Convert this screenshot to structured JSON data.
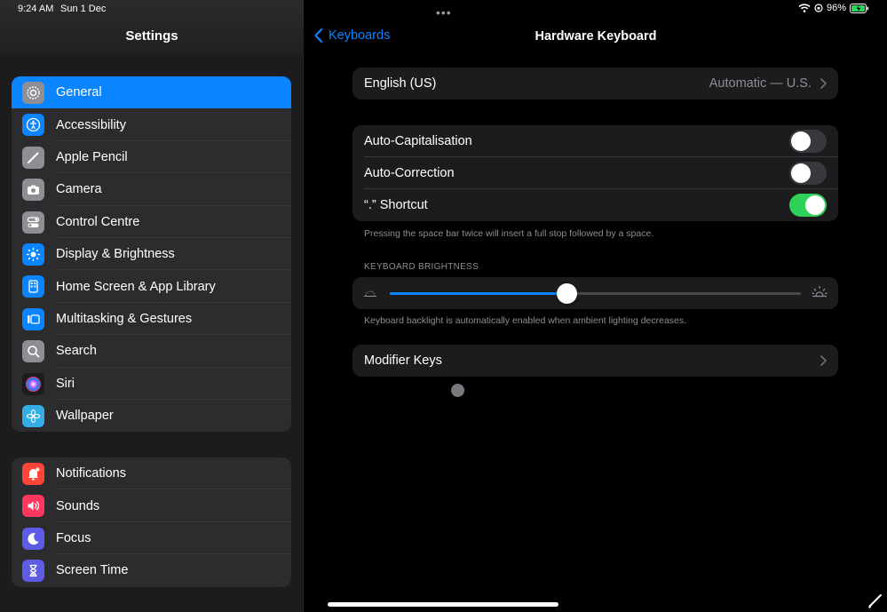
{
  "status_bar": {
    "time": "9:24 AM",
    "date": "Sun 1 Dec",
    "battery": "96%"
  },
  "sidebar": {
    "title": "Settings",
    "group1": [
      {
        "label": "General",
        "icon": "gear-icon",
        "color": "#8e8e93",
        "selected": true
      },
      {
        "label": "Accessibility",
        "icon": "accessibility-icon",
        "color": "#0a84ff"
      },
      {
        "label": "Apple Pencil",
        "icon": "pencil-icon",
        "color": "#8e8e93"
      },
      {
        "label": "Camera",
        "icon": "camera-icon",
        "color": "#8e8e93"
      },
      {
        "label": "Control Centre",
        "icon": "control-centre-icon",
        "color": "#8e8e93"
      },
      {
        "label": "Display & Brightness",
        "icon": "sun-icon",
        "color": "#0a84ff"
      },
      {
        "label": "Home Screen & App Library",
        "icon": "home-screen-icon",
        "color": "#0a84ff"
      },
      {
        "label": "Multitasking & Gestures",
        "icon": "multitasking-icon",
        "color": "#0a84ff"
      },
      {
        "label": "Search",
        "icon": "search-icon",
        "color": "#8e8e93"
      },
      {
        "label": "Siri",
        "icon": "siri-icon",
        "color": "#1c1c1e"
      },
      {
        "label": "Wallpaper",
        "icon": "flower-icon",
        "color": "#32ade6"
      }
    ],
    "group2": [
      {
        "label": "Notifications",
        "icon": "bell-icon",
        "color": "#ff453a"
      },
      {
        "label": "Sounds",
        "icon": "speaker-icon",
        "color": "#ff375f"
      },
      {
        "label": "Focus",
        "icon": "moon-icon",
        "color": "#5e5ce6"
      },
      {
        "label": "Screen Time",
        "icon": "hourglass-icon",
        "color": "#5e5ce6"
      }
    ]
  },
  "detail": {
    "back_label": "Keyboards",
    "title": "Hardware Keyboard",
    "language": {
      "label": "English (US)",
      "value": "Automatic — U.S."
    },
    "toggles": [
      {
        "label": "Auto-Capitalisation",
        "on": false
      },
      {
        "label": "Auto-Correction",
        "on": false
      },
      {
        "label": "“.” Shortcut",
        "on": true
      }
    ],
    "shortcut_footnote": "Pressing the space bar twice will insert a full stop followed by a space.",
    "brightness_header": "KEYBOARD BRIGHTNESS",
    "brightness_level": 0.43,
    "brightness_footnote": "Keyboard backlight is automatically enabled when ambient lighting decreases.",
    "modifier_keys_label": "Modifier Keys"
  },
  "colors": {
    "accent": "#0a84ff",
    "toggle_on": "#30d158"
  }
}
